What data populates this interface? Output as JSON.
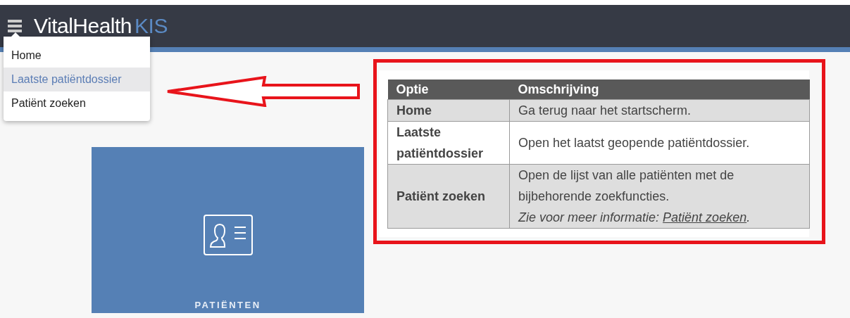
{
  "header": {
    "brand": "Vital",
    "brand_bold": "Health",
    "product": "KIS"
  },
  "menu": {
    "items": [
      {
        "label": "Home",
        "selected": false
      },
      {
        "label": "Laatste patiëntdossier",
        "selected": true
      },
      {
        "label": "Patiënt zoeken",
        "selected": false
      }
    ]
  },
  "tile": {
    "label": "PATIËNTEN"
  },
  "table": {
    "columns": [
      "Optie",
      "Omschrijving"
    ],
    "rows": [
      {
        "option": "Home",
        "description": "Ga terug naar het startscherm.",
        "shaded": true
      },
      {
        "option": "Laatste patiëntdossier",
        "description": "Open het laatst geopende patiëntdossier.",
        "shaded": false
      },
      {
        "option": "Patiënt zoeken",
        "description": "Open de lijst van alle patiënten met de bijbehorende zoekfuncties.",
        "note": {
          "text": "Zie voor meer informatie: ",
          "link": "Patiënt zoeken",
          "after": "."
        },
        "shaded": true
      }
    ]
  }
}
